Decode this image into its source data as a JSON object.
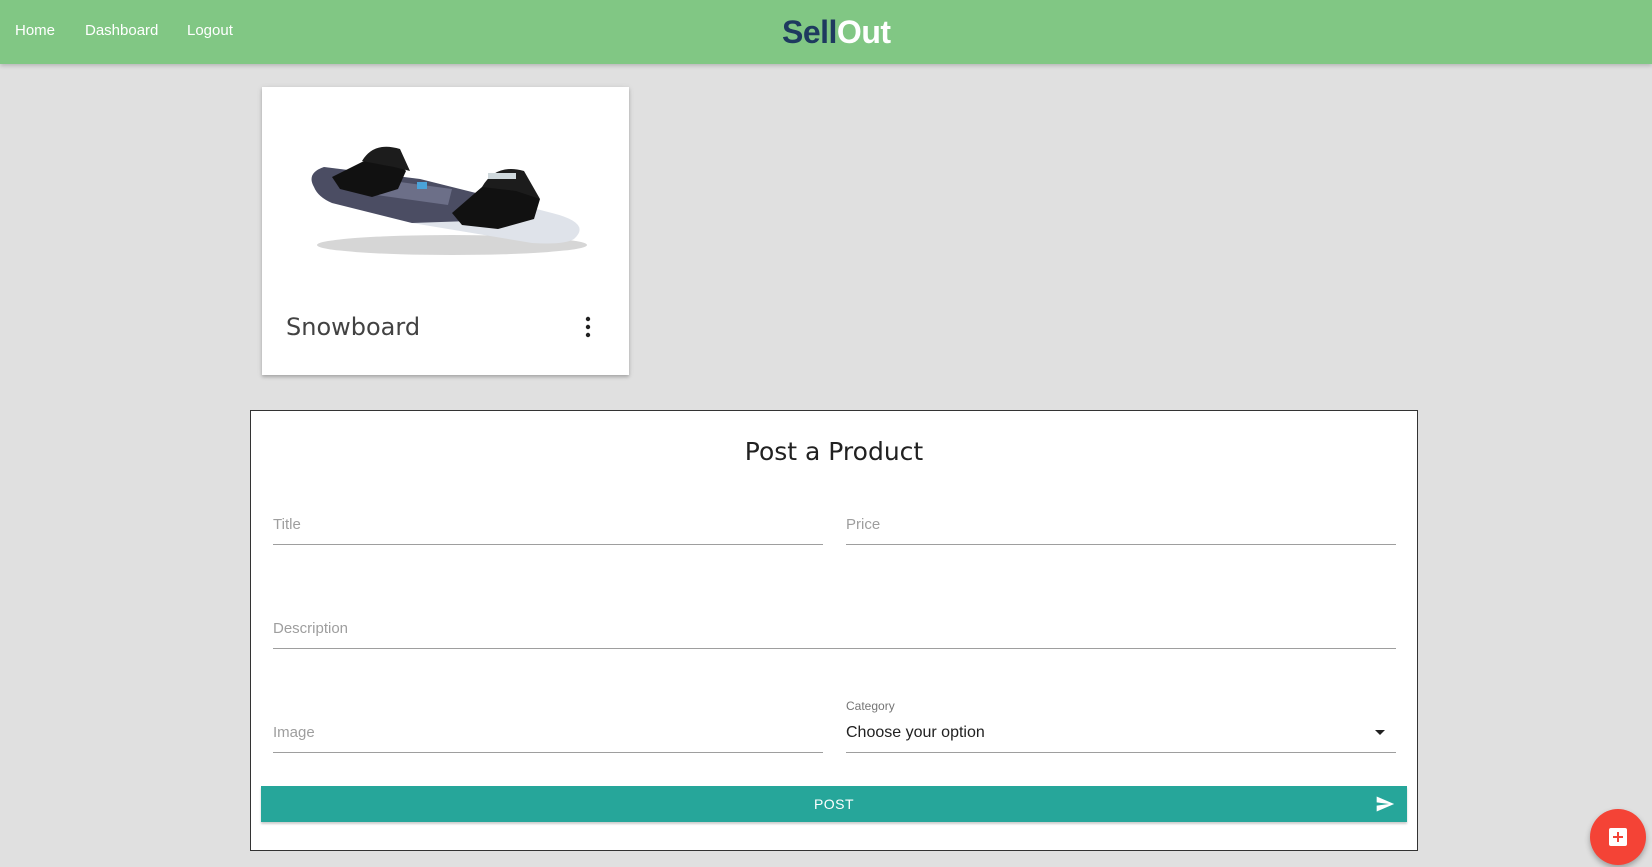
{
  "nav": {
    "links": [
      "Home",
      "Dashboard",
      "Logout"
    ],
    "brand_part1": "Sell",
    "brand_part2": "Out",
    "brand_color_dark": "#1e3a5f",
    "bar_color": "#81c784"
  },
  "product_card": {
    "title": "Snowboard",
    "image_icon": "snowboard-image",
    "menu_icon": "more-vert-icon"
  },
  "post_form": {
    "heading": "Post a Product",
    "title_placeholder": "Title",
    "price_placeholder": "Price",
    "description_placeholder": "Description",
    "image_placeholder": "Image",
    "category_label": "Category",
    "category_value": "Choose your option",
    "submit_label": "POST",
    "submit_icon": "send-icon",
    "button_color": "#26a69a"
  },
  "fab": {
    "icon": "add-box-icon",
    "color": "#f44336"
  }
}
